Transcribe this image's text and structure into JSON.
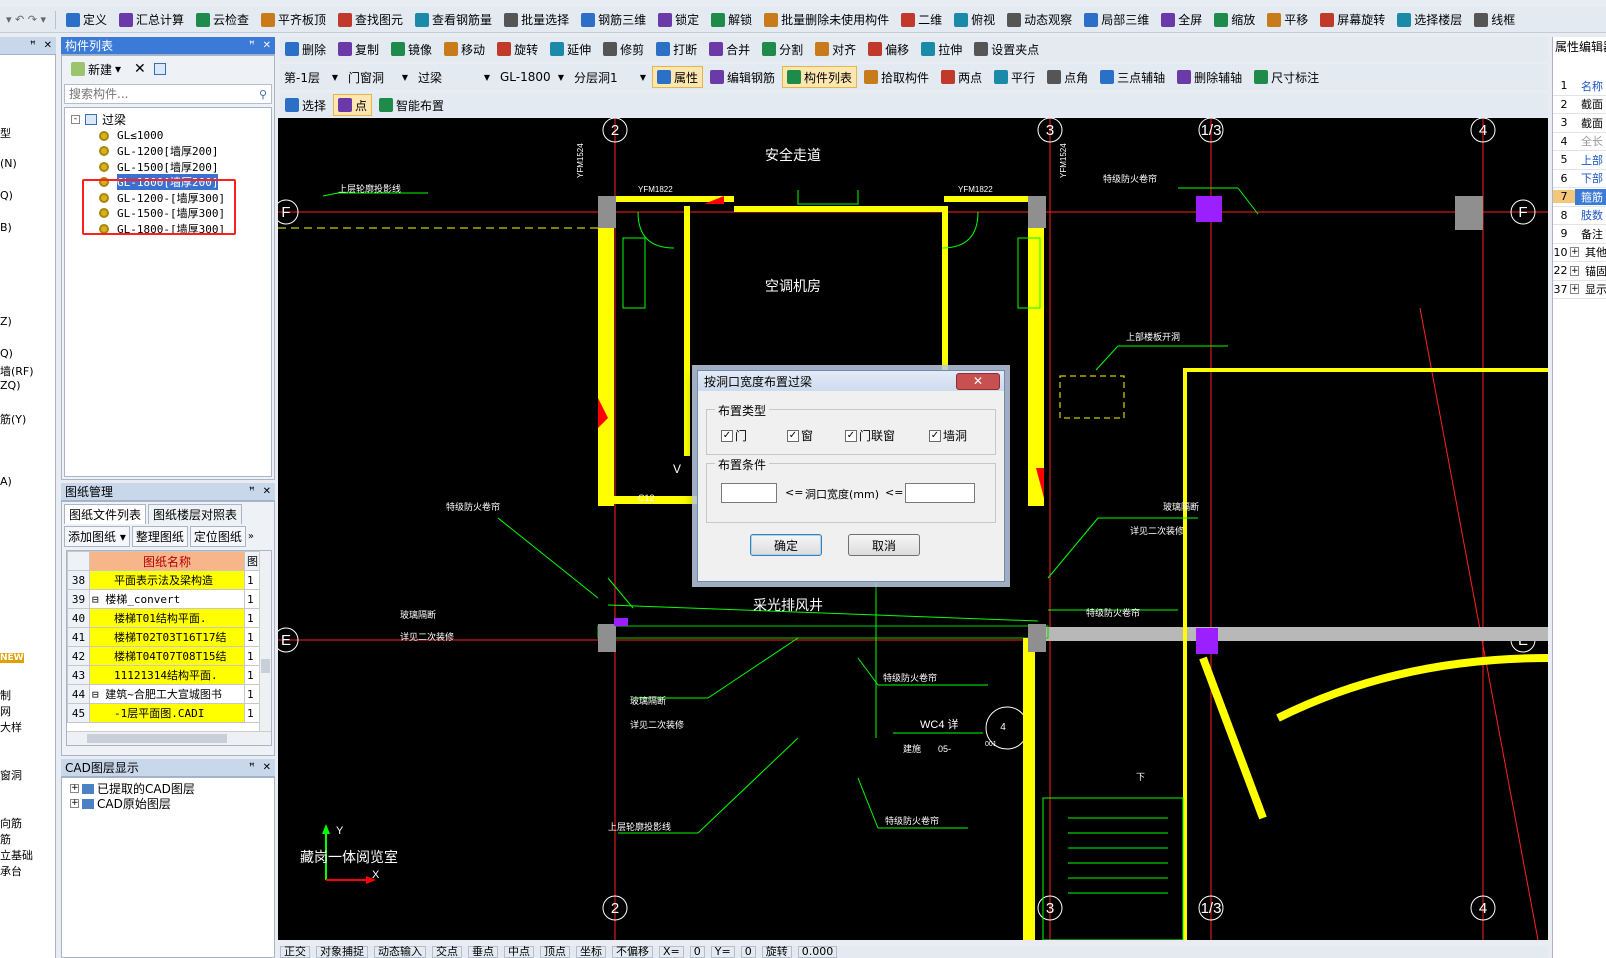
{
  "toolbar1": {
    "undo_redo": "▾",
    "items": [
      "定义",
      "汇总计算",
      "云检查",
      "平齐板顶",
      "查找图元",
      "查看钢筋量",
      "批量选择",
      "钢筋三维",
      "锁定",
      "解锁",
      "批量删除未使用构件",
      "二维",
      "俯视",
      "动态观察",
      "局部三维",
      "全屏",
      "缩放",
      "平移",
      "屏幕旋转",
      "选择楼层",
      "线框"
    ]
  },
  "toolbar2": {
    "items": [
      "删除",
      "复制",
      "镜像",
      "移动",
      "旋转",
      "延伸",
      "修剪",
      "打断",
      "合并",
      "分割",
      "对齐",
      "偏移",
      "拉伸",
      "设置夹点"
    ]
  },
  "toolbar3": {
    "floor": "第-1层",
    "category": "门窗洞",
    "type": "过梁",
    "component": "GL-1800",
    "layer": "分层洞1",
    "items": [
      "属性",
      "编辑钢筋",
      "构件列表",
      "拾取构件",
      "两点",
      "平行",
      "点角",
      "三点辅轴",
      "删除辅轴",
      "尺寸标注"
    ]
  },
  "toolbar4": {
    "items": [
      "选择",
      "点",
      "智能布置"
    ]
  },
  "component_panel": {
    "title": "构件列表",
    "new_label": "新建",
    "search_placeholder": "搜索构件...",
    "root": "过梁",
    "items": [
      "GL≤1000",
      "GL-1200[墙厚200]",
      "GL-1500[墙厚200]",
      "GL-1800[墙厚200]",
      "GL-1200-[墙厚300]",
      "GL-1500-[墙厚300]",
      "GL-1800-[墙厚300]"
    ]
  },
  "drawing_panel": {
    "title": "图纸管理",
    "tabs": [
      "图纸文件列表",
      "图纸楼层对照表"
    ],
    "buttons": [
      "添加图纸",
      "整理图纸",
      "定位图纸"
    ],
    "col_name": "图纸名称",
    "col_extra": "图",
    "rows": [
      {
        "no": "38",
        "name": "平面表示法及梁构造",
        "v": "1",
        "hl": true,
        "lvl": 1
      },
      {
        "no": "39",
        "name": "楼梯_convert",
        "v": "1",
        "hl": false,
        "lvl": 0
      },
      {
        "no": "40",
        "name": "楼梯T01结构平面.",
        "v": "1",
        "hl": true,
        "lvl": 1
      },
      {
        "no": "41",
        "name": "楼梯T02T03T16T17结",
        "v": "1",
        "hl": true,
        "lvl": 1
      },
      {
        "no": "42",
        "name": "楼梯T04T07T08T15结",
        "v": "1",
        "hl": true,
        "lvl": 1
      },
      {
        "no": "43",
        "name": "11121314结构平面.",
        "v": "1",
        "hl": true,
        "lvl": 1
      },
      {
        "no": "44",
        "name": "建筑~合肥工大宣城图书",
        "v": "1",
        "hl": false,
        "lvl": 0
      },
      {
        "no": "45",
        "name": "-1层平面图.CADI",
        "v": "1",
        "hl": true,
        "lvl": 1
      }
    ]
  },
  "cad_layer_panel": {
    "title": "CAD图层显示",
    "items": [
      "已提取的CAD图层",
      "CAD原始图层"
    ]
  },
  "nav_left": {
    "items": [
      "型",
      "(N)",
      "Q)",
      "B)",
      "Z)",
      "Q)",
      "墙(RF)",
      "ZQ)",
      "筋(Y)",
      "A)",
      "NEW",
      "制",
      "网",
      "大样",
      "窗洞",
      "向筋",
      "筋",
      "立基础",
      "承台"
    ]
  },
  "property_panel": {
    "title": "属性编辑器",
    "rows": [
      {
        "no": "1",
        "label": "名称",
        "style": "blue"
      },
      {
        "no": "2",
        "label": "截面",
        "style": "black"
      },
      {
        "no": "3",
        "label": "截面",
        "style": "black"
      },
      {
        "no": "4",
        "label": "全长",
        "style": "gray"
      },
      {
        "no": "5",
        "label": "上部",
        "style": "blue"
      },
      {
        "no": "6",
        "label": "下部",
        "style": "blue"
      },
      {
        "no": "7",
        "label": "箍筋",
        "style": "sel"
      },
      {
        "no": "8",
        "label": "肢数",
        "style": "blue"
      },
      {
        "no": "9",
        "label": "备注",
        "style": "black"
      },
      {
        "no": "10",
        "label": "其他",
        "style": "plus"
      },
      {
        "no": "22",
        "label": "锚固",
        "style": "plus"
      },
      {
        "no": "37",
        "label": "显示",
        "style": "plus"
      }
    ]
  },
  "cad": {
    "axis_labels": [
      "2",
      "3",
      "1/3",
      "4",
      "F",
      "E"
    ],
    "rooms": [
      "安全走道",
      "空调机房",
      "采光排风井"
    ],
    "annotations": [
      "上层轮廓投影线",
      "特级防火卷帘",
      "上部楼板开洞",
      "特级防火卷帘",
      "玻璃隔断",
      "详见二次装修",
      "玻璃隔断",
      "详见二次装修",
      "特级防火卷帘",
      "玻璃隔断",
      "详见二次装修",
      "特级防火卷帘",
      "上层轮廓投影线",
      "特级防火卷帘",
      "WC4 详",
      "建施",
      "05-",
      "下"
    ],
    "door_labels": [
      "YFM1524",
      "YFM1524",
      "YFM1822",
      "YFM1822",
      "C12",
      "V"
    ],
    "detail": {
      "num": "4",
      "sub": "001"
    },
    "watermark": "藏岗一体阅览室",
    "coord": {
      "x": "X",
      "y": "Y"
    }
  },
  "dialog": {
    "title": "按洞口宽度布置过梁",
    "group_type": "布置类型",
    "checks": [
      "门",
      "窗",
      "门联窗",
      "墙洞"
    ],
    "group_cond": "布置条件",
    "op1": "<=",
    "width_label": "洞口宽度(mm)",
    "op2": "<=",
    "min_value": "",
    "max_value": "",
    "ok": "确定",
    "cancel": "取消"
  },
  "statusbar": {
    "items": [
      "正交",
      "对象捕捉",
      "动态输入",
      "交点",
      "垂点",
      "中点",
      "顶点",
      "坐标",
      "不偏移",
      "X=",
      "0",
      "Y=",
      "0",
      "旋转",
      "0.000"
    ]
  },
  "colors": {
    "accent": "#3b7ad6",
    "highlight": "#ffff00",
    "cad_bg": "#000000",
    "wall": "#ffff00",
    "axis": "#ff0000"
  }
}
